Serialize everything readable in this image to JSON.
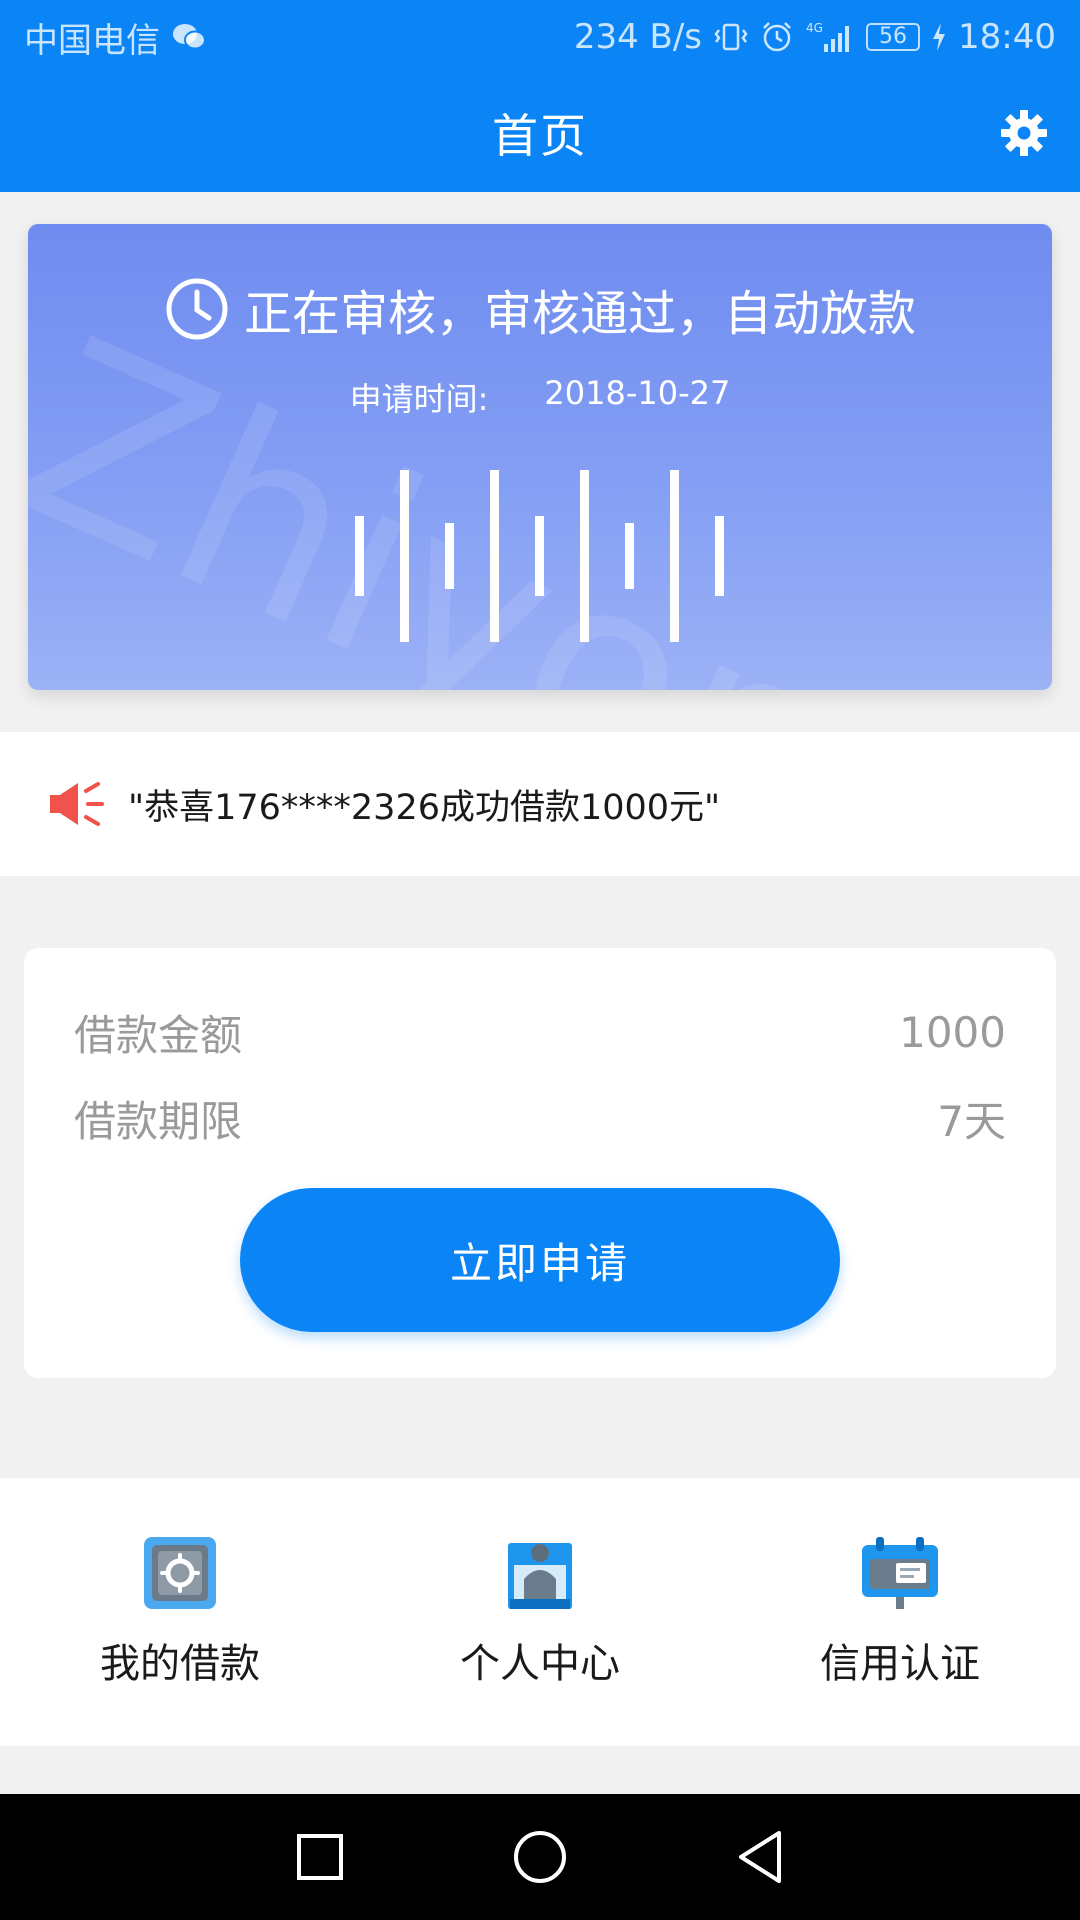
{
  "status_bar": {
    "carrier": "中国电信",
    "net_speed": "234 B/s",
    "battery": "56",
    "time": "18:40",
    "icons": [
      "wechat-icon",
      "vibrate-icon",
      "alarm-icon",
      "signal-4g-icon",
      "battery-icon",
      "charging-icon"
    ]
  },
  "header": {
    "title": "首页",
    "settings_icon": "gear-icon"
  },
  "review": {
    "status": "正在审核，审核通过，自动放款",
    "date_label": "申请时间:",
    "date_value": "2018-10-27",
    "watermark": "Zhiyong",
    "icon": "clock-icon"
  },
  "notice": {
    "icon": "megaphone-icon",
    "text": "\"恭喜176****2326成功借款1000元\""
  },
  "loan": {
    "amount_label": "借款金额",
    "amount_value": "1000",
    "term_label": "借款期限",
    "term_value": "7天",
    "apply_label": "立即申请"
  },
  "menu": {
    "items": [
      {
        "label": "我的借款",
        "icon": "safe-icon"
      },
      {
        "label": "个人中心",
        "icon": "person-icon"
      },
      {
        "label": "信用认证",
        "icon": "id-card-icon"
      }
    ]
  },
  "colors": {
    "primary": "#0b85f6",
    "card_gradient_top": "#6f8cf0",
    "card_gradient_bottom": "#9cb2f6",
    "notice_icon": "#f0534b",
    "label_gray": "#9a9a9a"
  }
}
